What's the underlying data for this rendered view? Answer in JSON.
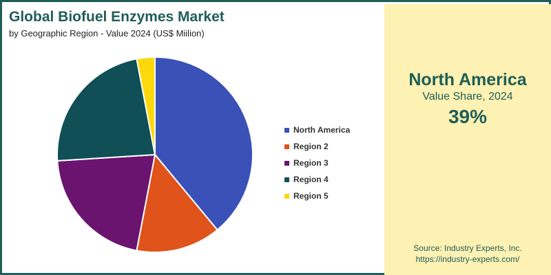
{
  "header": {
    "title": "Global Biofuel Enzymes Market",
    "subtitle": "by Geographic Region - Value 2024 (US$ Miilion)"
  },
  "chart_data": {
    "type": "pie",
    "title": "Global Biofuel Enzymes Market",
    "subtitle": "by Geographic Region - Value 2024 (US$ Miilion)",
    "categories": [
      "North America",
      "Region 2",
      "Region 3",
      "Region 4",
      "Region 5"
    ],
    "values": [
      39,
      14,
      21,
      23,
      3
    ],
    "colors": [
      "#3a51b8",
      "#e0531a",
      "#6a1470",
      "#0f4f55",
      "#fcd80c"
    ],
    "start": "12 o'clock",
    "direction": "clockwise",
    "legend": "right"
  },
  "highlight": {
    "region": "North America",
    "label": "Value Share, 2024",
    "value": "39%"
  },
  "source": {
    "line1": "Source: Industry Experts, Inc.",
    "line2": "https://industry-experts.com/"
  },
  "colors": {
    "accent": "#1f5e57",
    "panel": "#fdf1b3"
  }
}
